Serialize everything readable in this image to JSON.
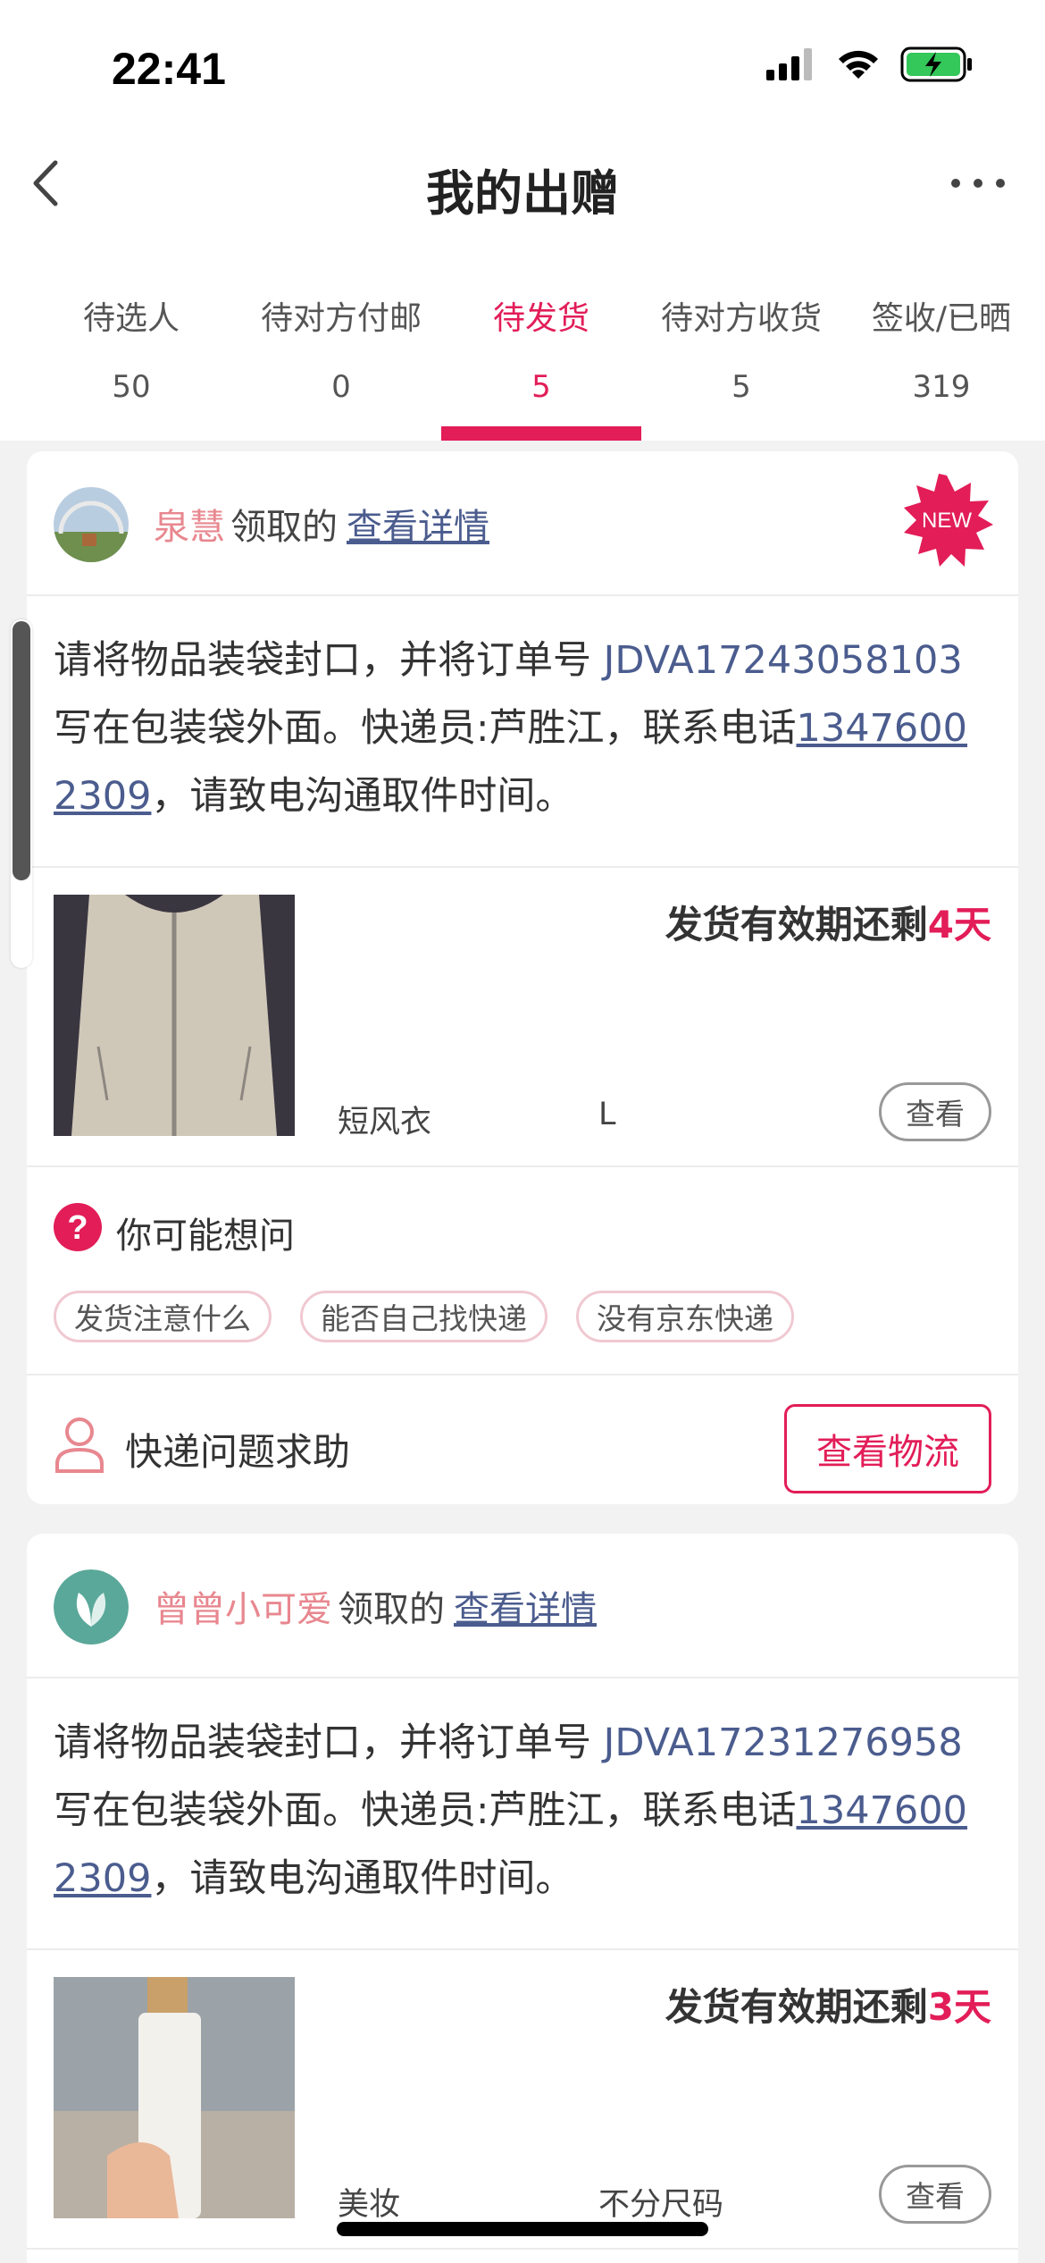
{
  "status_bar": {
    "time": "22:41"
  },
  "nav": {
    "title": "我的出赠"
  },
  "tabs": [
    {
      "label": "待选人",
      "count": "50"
    },
    {
      "label": "待对方付邮",
      "count": "0"
    },
    {
      "label": "待发货",
      "count": "5",
      "active": true
    },
    {
      "label": "待对方收货",
      "count": "5"
    },
    {
      "label": "签收/已晒",
      "count": "319"
    }
  ],
  "cards": [
    {
      "user": "泉慧",
      "claimed_text": "领取的",
      "detail_link": "查看详情",
      "badge": "NEW",
      "instruction_prefix": "请将物品装袋封口，并将订单号 ",
      "order_no": "JDVA17243058103",
      "instruction_mid": " 写在包装袋外面。快递员:芦胜江，联系电话",
      "phone": "13476002309",
      "instruction_suffix": "，请致电沟通取件时间。",
      "deadline_prefix": "发货有效期还剩",
      "deadline_days": "4天",
      "item_name": "短风衣",
      "item_size": "L",
      "view_label": "查看",
      "faq_title": "你可能想问",
      "faq_chips": [
        "发货注意什么",
        "能否自己找快递",
        "没有京东快递"
      ],
      "help_text": "快递问题求助",
      "logistics_label": "查看物流"
    },
    {
      "user": "曾曾小可爱",
      "claimed_text": "领取的",
      "detail_link": "查看详情",
      "instruction_prefix": "请将物品装袋封口，并将订单号 ",
      "order_no": "JDVA17231276958",
      "instruction_mid": " 写在包装袋外面。快递员:芦胜江，联系电话",
      "phone": "13476002309",
      "instruction_suffix": "，请致电沟通取件时间。",
      "deadline_prefix": "发货有效期还剩",
      "deadline_days": "3天",
      "item_name": "美妆",
      "item_size": "不分尺码",
      "view_label": "查看"
    }
  ],
  "colors": {
    "accent": "#e21d58",
    "link": "#4b5c8e",
    "username": "#e8878f"
  }
}
